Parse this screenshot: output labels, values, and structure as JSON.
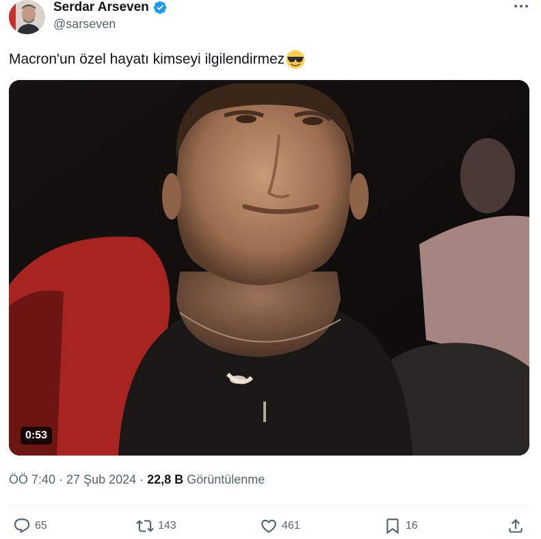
{
  "author": {
    "display_name": "Serdar Arseven",
    "handle": "@sarseven",
    "verified_icon": "verified-badge-icon",
    "verified_color": "#1d9bf0"
  },
  "tweet": {
    "text": "Macron'un özel hayatı kimseyi ilgilendirmez",
    "emoji": "smiling-face-with-sunglasses-icon"
  },
  "media": {
    "duration": "0:53"
  },
  "meta": {
    "time": "ÖÖ 7:40",
    "sep1": " · ",
    "date": "27 Şub 2024",
    "sep2": " · ",
    "views_count": "22,8 B",
    "views_label": " Görüntülenme"
  },
  "actions": {
    "reply_count": "65",
    "retweet_count": "143",
    "like_count": "461",
    "bookmark_count": "16"
  },
  "colors": {
    "text": "#0f1419",
    "secondary": "#536471",
    "accent": "#1d9bf0"
  }
}
